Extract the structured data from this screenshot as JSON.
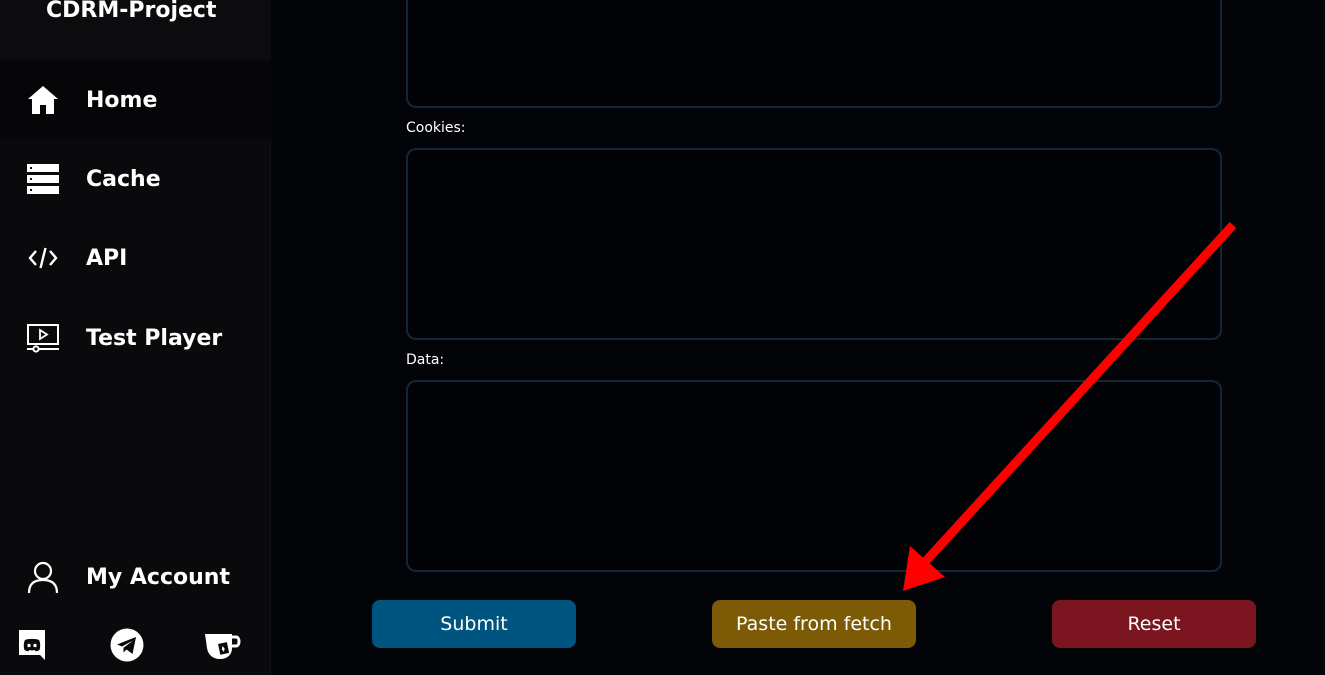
{
  "sidebar": {
    "brand": "CDRM-Project",
    "nav": [
      {
        "label": "Home",
        "icon": "home-icon"
      },
      {
        "label": "Cache",
        "icon": "server-icon"
      },
      {
        "label": "API",
        "icon": "code-icon"
      },
      {
        "label": "Test Player",
        "icon": "video-player-icon"
      }
    ],
    "account": {
      "label": "My Account",
      "icon": "user-icon"
    },
    "social": [
      {
        "icon": "discord-icon"
      },
      {
        "icon": "telegram-icon"
      },
      {
        "icon": "ko-fi-cup-icon"
      }
    ]
  },
  "form": {
    "cookies_label": "Cookies:",
    "data_label": "Data:",
    "headers_value": "",
    "cookies_value": "",
    "data_value": ""
  },
  "buttons": {
    "submit": "Submit",
    "paste": "Paste from fetch",
    "reset": "Reset"
  },
  "colors": {
    "submit": "#005580",
    "paste": "#7d5a06",
    "reset": "#7b1620",
    "annotation_arrow": "#ff0000"
  }
}
